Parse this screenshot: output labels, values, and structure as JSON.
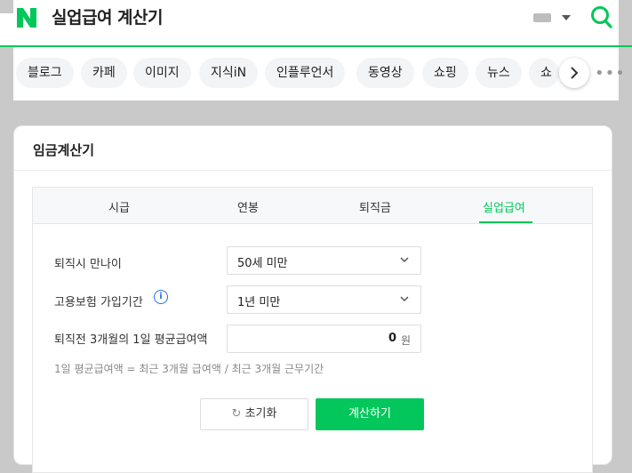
{
  "header": {
    "logo": "N",
    "query": "실업급여 계산기",
    "icons": {
      "keyboard": "keyboard-icon",
      "search": "search-icon"
    },
    "accent": "#03c75a"
  },
  "nav": {
    "chips": [
      "블로그",
      "카페",
      "이미지",
      "지식iN",
      "인플루언서",
      "동영상",
      "쇼핑",
      "뉴스",
      "쇼"
    ]
  },
  "calculator": {
    "title": "임금계산기",
    "tabs": [
      "시급",
      "연봉",
      "퇴직금",
      "실업급여"
    ],
    "active_tab": "실업급여",
    "age_label": "퇴직시 만나이",
    "age_value": "50세 미만",
    "insurance_label": "고용보험 가입기간",
    "insurance_value": "1년 미만",
    "wage_label": "퇴직전 3개월의 1일 평균급여액",
    "wage_value": "0",
    "wage_unit": "원",
    "formula": "1일 평균급여액 = 최근 3개월 급여액 / 최근 3개월 근무기간",
    "reset_label": "초기화",
    "calc_label": "계산하기"
  }
}
